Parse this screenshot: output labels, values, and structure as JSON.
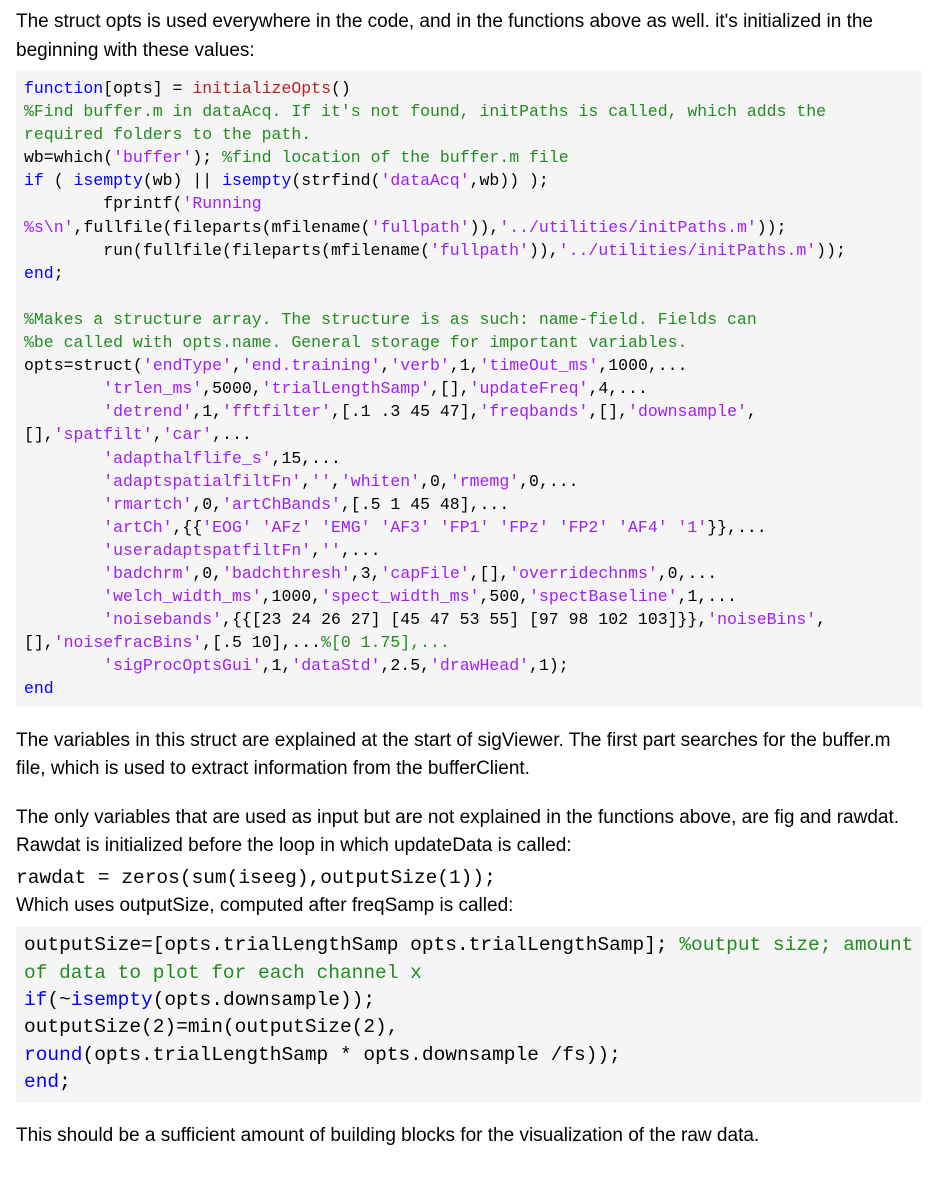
{
  "para1": "The struct opts is used everywhere in the code, and in the functions above as well. it's initialized in the beginning with these values:",
  "code1": {
    "l1a": "function",
    "l1b": "[opts] = ",
    "l1c": "initializeOpts",
    "l1d": "()",
    "l2": "%Find buffer.m in dataAcq. If it's not found, initPaths is called, which adds the required folders to the path.",
    "l3a": "wb=which(",
    "l3b": "'buffer'",
    "l3c": "); ",
    "l3d": "%find location of the buffer.m file",
    "l4a": "if",
    "l4b": " ( ",
    "l4c": "isempty",
    "l4d": "(wb) || ",
    "l4e": "isempty",
    "l4f": "(strfind(",
    "l4g": "'dataAcq'",
    "l4h": ",wb)) );",
    "l5a": "        fprintf(",
    "l5b": "'Running %s\\n'",
    "l5c": ",fullfile(fileparts(mfilename(",
    "l5d": "'fullpath'",
    "l5e": ")),",
    "l5f": "'../utilities/initPaths.m'",
    "l5g": "));",
    "l6a": "        run(fullfile(fileparts(mfilename(",
    "l6b": "'fullpath'",
    "l6c": ")),",
    "l6d": "'../utilities/initPaths.m'",
    "l6e": "));",
    "l7": "end",
    "l7b": ";",
    "l8": "",
    "l9": "%Makes a structure array. The structure is as such: name-field. Fields can",
    "l10": "%be called with opts.name. General storage for important variables.",
    "l11a": "opts=struct(",
    "l11b": "'endType'",
    "l11c": ",",
    "l11d": "'end.training'",
    "l11e": ",",
    "l11f": "'verb'",
    "l11g": ",1,",
    "l11h": "'timeOut_ms'",
    "l11i": ",1000,...",
    "l12a": "        ",
    "l12b": "'trlen_ms'",
    "l12c": ",5000,",
    "l12d": "'trialLengthSamp'",
    "l12e": ",[],",
    "l12f": "'updateFreq'",
    "l12g": ",4,...",
    "l13a": "        ",
    "l13b": "'detrend'",
    "l13c": ",1,",
    "l13d": "'fftfilter'",
    "l13e": ",[.1 .3 45 47],",
    "l13f": "'freqbands'",
    "l13g": ",[],",
    "l13h": "'downsample'",
    "l13i": ",[],",
    "l13j": "'spatfilt'",
    "l13k": ",",
    "l13l": "'car'",
    "l13m": ",...",
    "l14a": "        ",
    "l14b": "'adapthalflife_s'",
    "l14c": ",15,...",
    "l15a": "        ",
    "l15b": "'adaptspatialfiltFn'",
    "l15c": ",",
    "l15d": "''",
    "l15e": ",",
    "l15f": "'whiten'",
    "l15g": ",0,",
    "l15h": "'rmemg'",
    "l15i": ",0,...",
    "l16a": "        ",
    "l16b": "'rmartch'",
    "l16c": ",0,",
    "l16d": "'artChBands'",
    "l16e": ",[.5 1 45 48],...",
    "l17a": "        ",
    "l17b": "'artCh'",
    "l17c": ",{{",
    "l17d": "'EOG' 'AFz' 'EMG' 'AF3' 'FP1' 'FPz' 'FP2' 'AF4' '1'",
    "l17e": "}},...",
    "l18a": "        ",
    "l18b": "'useradaptspatfiltFn'",
    "l18c": ",",
    "l18d": "''",
    "l18e": ",...",
    "l19a": "        ",
    "l19b": "'badchrm'",
    "l19c": ",0,",
    "l19d": "'badchthresh'",
    "l19e": ",3,",
    "l19f": "'capFile'",
    "l19g": ",[],",
    "l19h": "'overridechnms'",
    "l19i": ",0,...",
    "l20a": "        ",
    "l20b": "'welch_width_ms'",
    "l20c": ",1000,",
    "l20d": "'spect_width_ms'",
    "l20e": ",500,",
    "l20f": "'spectBaseline'",
    "l20g": ",1,...",
    "l21a": "        ",
    "l21b": "'noisebands'",
    "l21c": ",{{[23 24 26 27] [45 47 53 55] [97 98 102 103]}},",
    "l21d": "'noiseBins'",
    "l21e": ",[],",
    "l21f": "'noisefracBins'",
    "l21g": ",[.5 10],...",
    "l21h": "%[0 1.75],...",
    "l22a": "        ",
    "l22b": "'sigProcOptsGui'",
    "l22c": ",1,",
    "l22d": "'dataStd'",
    "l22e": ",2.5,",
    "l22f": "'drawHead'",
    "l22g": ",1);",
    "l23": "end"
  },
  "para2": "The variables in this struct are explained at the start of sigViewer. The first part searches for the buffer.m file, which is used to extract information from the bufferClient.",
  "para3": "The only variables that are used as input but are not explained in the functions above, are fig and rawdat. Rawdat is initialized before the loop in which updateData is called:",
  "codeline1": "rawdat = zeros(sum(iseeg),outputSize(1));",
  "para4": "Which uses outputSize, computed after freqSamp is called:",
  "code2": {
    "l1a": "outputSize=[opts.trialLengthSamp opts.trialLengthSamp]; ",
    "l1b": "%output size; amount of data to plot for each channel x",
    "l2a": "if",
    "l2b": "(~",
    "l2c": "isempty",
    "l2d": "(opts.downsample));",
    "l3": "outputSize(2)=min(outputSize(2), ",
    "l4a": "round",
    "l4b": "(opts.trialLengthSamp * opts.downsample /fs));",
    "l5a": "end",
    "l5b": ";"
  },
  "para5": "This should be a sufficient amount of building blocks for the visualization of the raw data."
}
